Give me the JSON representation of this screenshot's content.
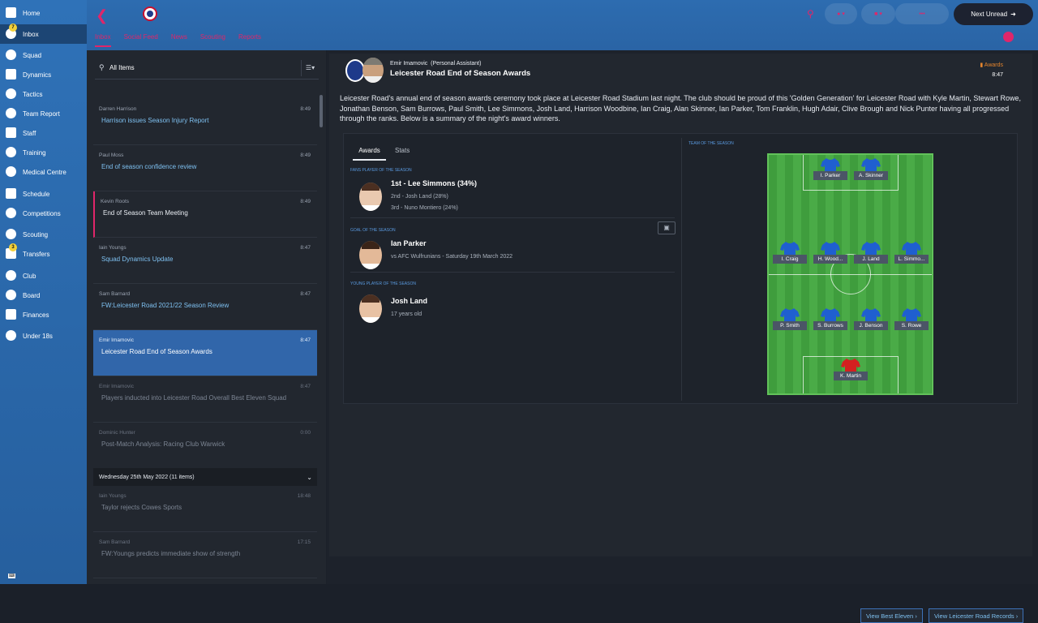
{
  "nav": {
    "items": [
      {
        "label": "Home",
        "icon": "home-icon"
      },
      {
        "label": "Inbox",
        "icon": "inbox-icon",
        "badge": "7"
      },
      {
        "label": "Squad",
        "icon": "squad-icon"
      },
      {
        "label": "Dynamics",
        "icon": "dynamics-icon"
      },
      {
        "label": "Tactics",
        "icon": "tactics-icon"
      },
      {
        "label": "Team Report",
        "icon": "team-report-icon"
      },
      {
        "label": "Staff",
        "icon": "staff-icon"
      },
      {
        "label": "Training",
        "icon": "training-icon"
      },
      {
        "label": "Medical Centre",
        "icon": "medical-icon"
      },
      {
        "label": "Schedule",
        "icon": "schedule-icon"
      },
      {
        "label": "Competitions",
        "icon": "trophy-icon"
      },
      {
        "label": "Scouting",
        "icon": "scouting-icon"
      },
      {
        "label": "Transfers",
        "icon": "transfers-icon",
        "badge": "3"
      },
      {
        "label": "Club",
        "icon": "club-icon"
      },
      {
        "label": "Board",
        "icon": "board-icon"
      },
      {
        "label": "Finances",
        "icon": "finances-icon"
      },
      {
        "label": "Under 18s",
        "icon": "under18-icon"
      }
    ]
  },
  "header": {
    "tabs": [
      "Inbox",
      "Social Feed",
      "News",
      "Scouting",
      "Reports"
    ],
    "next_unread": "Next Unread"
  },
  "list": {
    "filter_label": "All Items",
    "messages": [
      {
        "sender": "Darren Harrison",
        "time": "8:49",
        "subject": "Harrison issues Season Injury Report",
        "state": "unread"
      },
      {
        "sender": "Paul Moss",
        "time": "8:49",
        "subject": "End of season confidence review",
        "state": "unread"
      },
      {
        "sender": "Kevin Roots",
        "time": "8:49",
        "subject": "End of Season Team Meeting",
        "state": "flag"
      },
      {
        "sender": "Iain Youngs",
        "time": "8:47",
        "subject": "Squad Dynamics Update",
        "state": "unread"
      },
      {
        "sender": "Sam Barnard",
        "time": "8:47",
        "subject": "FW:Leicester Road 2021/22 Season Review",
        "state": "unread"
      },
      {
        "sender": "Emir Imamovic",
        "time": "8:47",
        "subject": "Leicester Road End of Season Awards",
        "state": "selected"
      },
      {
        "sender": "Emir Imamovic",
        "time": "8:47",
        "subject": "Players inducted into Leicester Road Overall Best Eleven Squad",
        "state": "read"
      },
      {
        "sender": "Dominic Hunter",
        "time": "0:00",
        "subject": "Post-Match Analysis: Racing Club Warwick",
        "state": "read"
      }
    ],
    "date_group": "Wednesday 25th May 2022 (11 items)",
    "older_messages": [
      {
        "sender": "Iain Youngs",
        "time": "18:48",
        "subject": "Taylor rejects Cowes Sports",
        "state": "read"
      },
      {
        "sender": "Sam Barnard",
        "time": "17:15",
        "subject": "FW:Youngs predicts immediate show of strength",
        "state": "read"
      }
    ]
  },
  "detail": {
    "from_name": "Emir Imamovic",
    "from_role": "(Personal Assistant)",
    "title": "Leicester Road End of Season Awards",
    "tag": "Awards",
    "time": "8:47",
    "body": "Leicester Road's annual end of season awards ceremony took place at Leicester Road Stadium last night. The club should be proud of this 'Golden Generation' for Leicester Road with Kyle Martin, Stewart Rowe, Jonathan Benson, Sam Burrows, Paul Smith, Lee Simmons, Josh Land, Harrison Woodbine, Ian Craig, Alan Skinner, Ian Parker, Tom Franklin, Hugh Adair, Clive Brough and Nick Punter having all progressed through the ranks. Below is a summary of the night's award winners.",
    "awards_tab": "Awards",
    "stats_tab": "Stats",
    "fans_title": "FANS PLAYER OF THE SEASON",
    "fans_first": "1st - Lee Simmons (34%)",
    "fans_second": "2nd - Josh Land (28%)",
    "fans_third": "3rd - Nuno Montiero (24%)",
    "goal_title": "GOAL OF THE SEASON",
    "goal_player": "Ian Parker",
    "goal_match": "vs AFC Wulfrunians - Saturday 19th March 2022",
    "young_title": "YOUNG PLAYER OF THE SEASON",
    "young_player": "Josh Land",
    "young_age": "17 years old",
    "team_title": "TEAM OF THE SEASON",
    "team": [
      "I. Parker",
      "A. Skinner",
      "I. Craig",
      "H. Wood...",
      "J. Land",
      "L. Simmo...",
      "P. Smith",
      "S. Burrows",
      "J. Benson",
      "S. Rowe",
      "K. Martin"
    ],
    "btn_best_eleven": "View Best Eleven",
    "btn_records": "View Leicester Road Records"
  },
  "colors": {
    "accent": "#e0266a",
    "nav": "#2f72b8",
    "link": "#7ec0f0",
    "section": "#5a9ae0",
    "award_tag": "#e3842d",
    "outfield_shirt": "#1f5fd0",
    "keeper_shirt": "#d42020"
  }
}
